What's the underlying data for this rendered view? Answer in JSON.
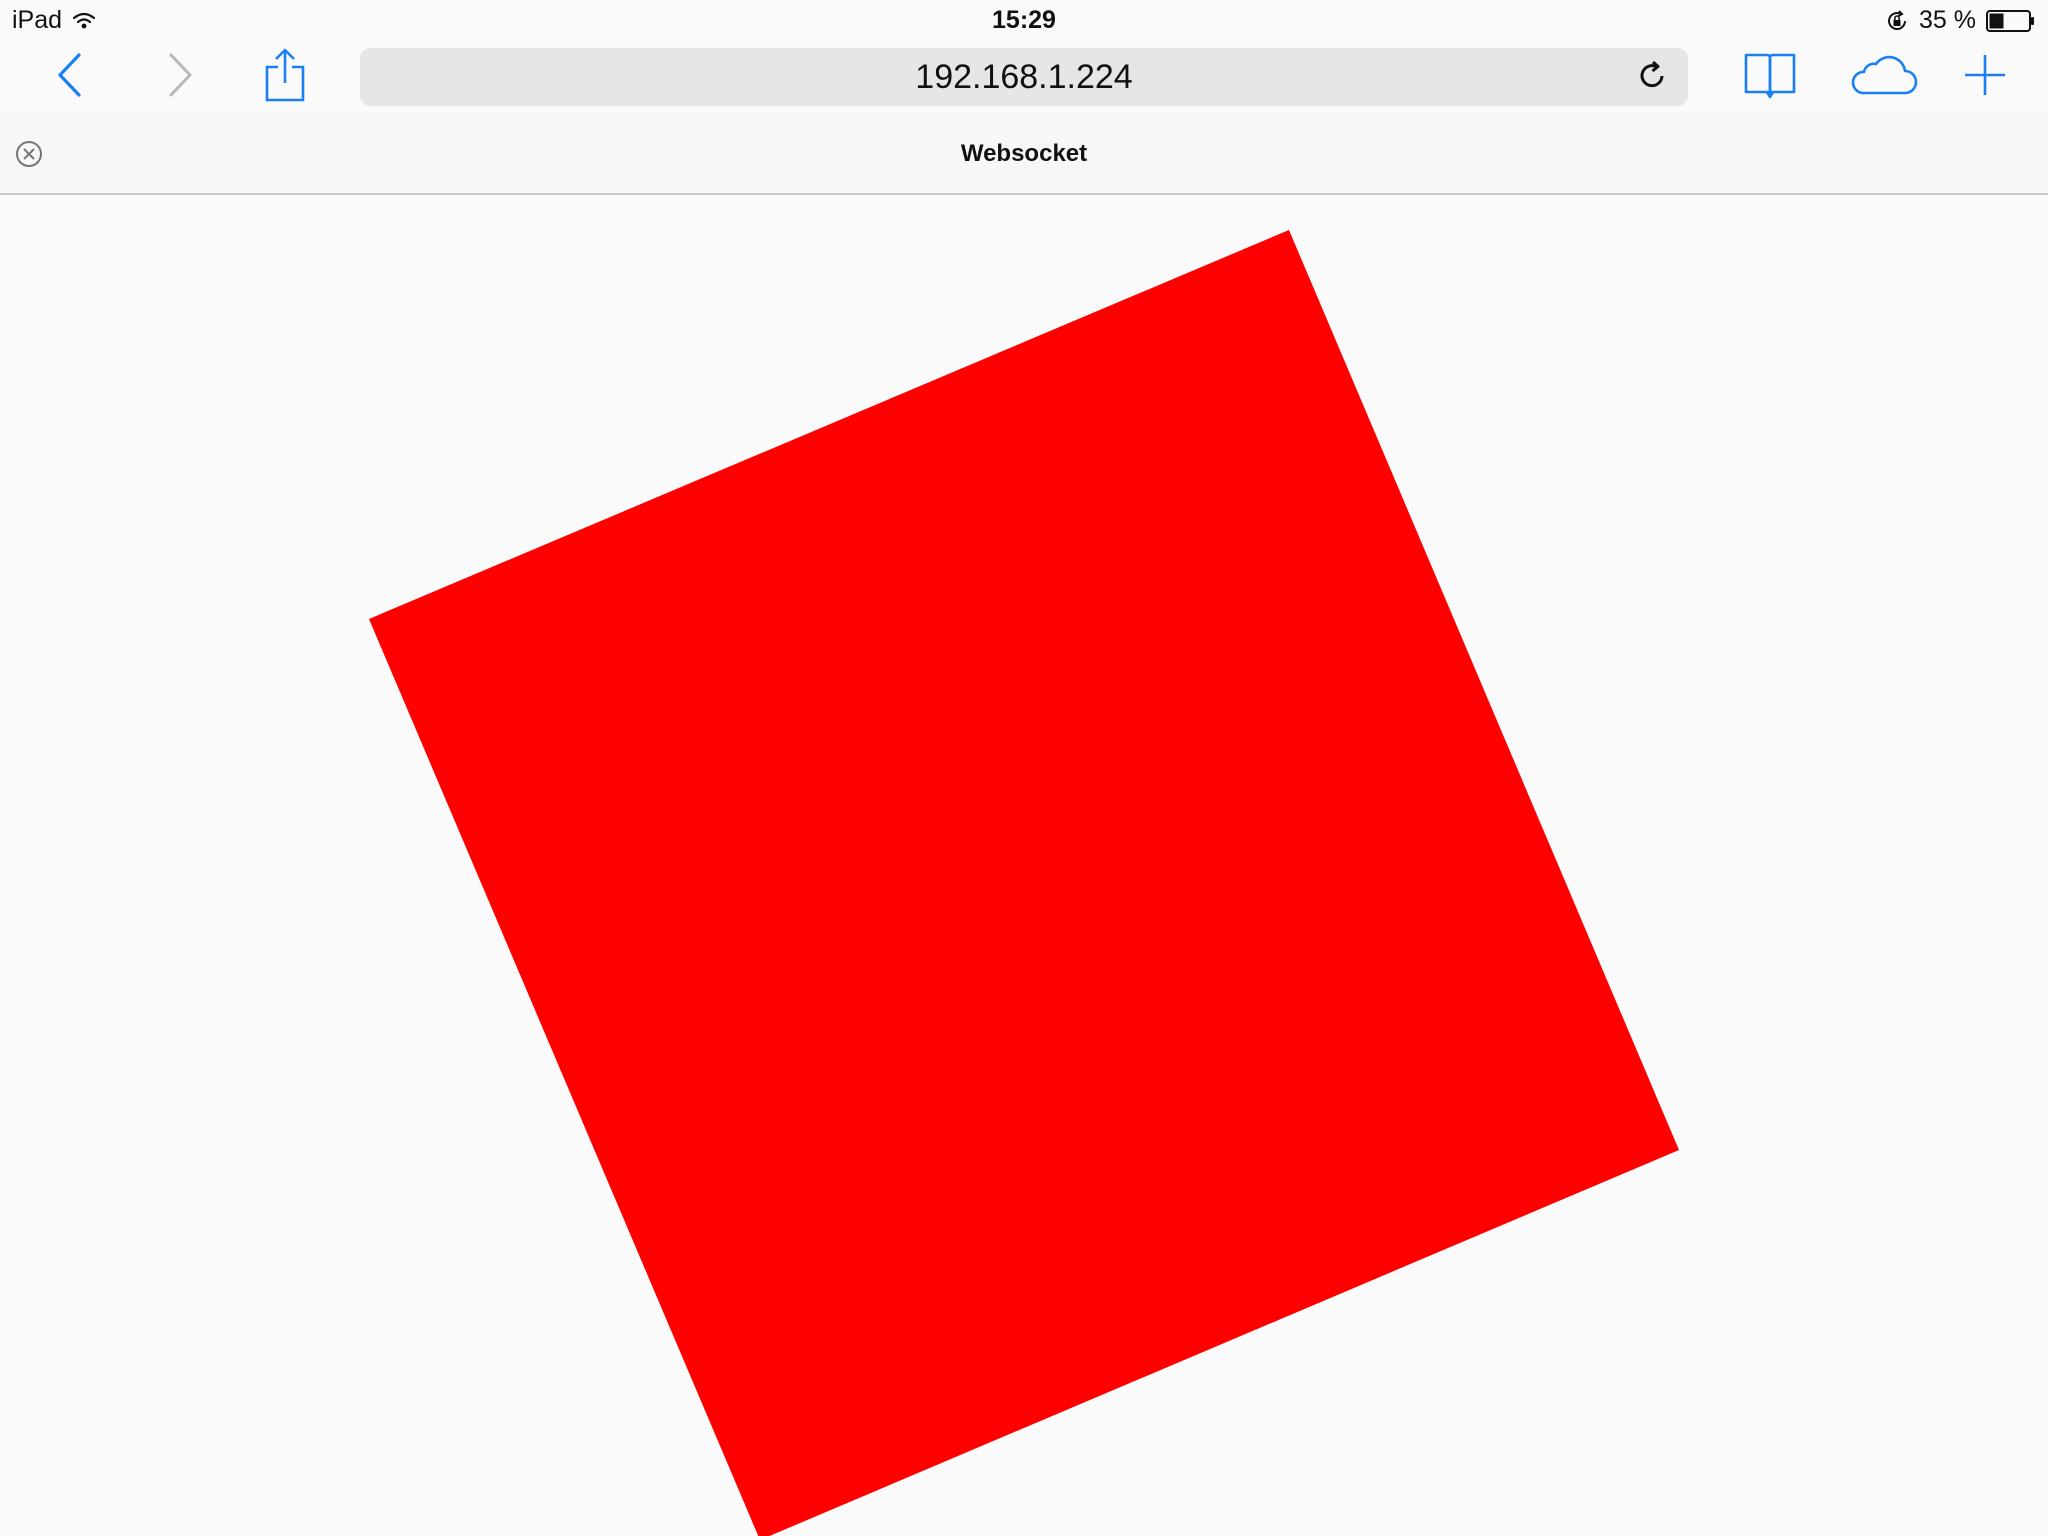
{
  "status_bar": {
    "device": "iPad",
    "time": "15:29",
    "battery": "35 %"
  },
  "toolbar": {
    "url": "192.168.1.224"
  },
  "tab": {
    "title": "Websocket"
  },
  "content": {
    "shape_color": "#ff0000"
  },
  "colors": {
    "accent": "#1a7ff5",
    "disabled": "#b8b8b8"
  }
}
